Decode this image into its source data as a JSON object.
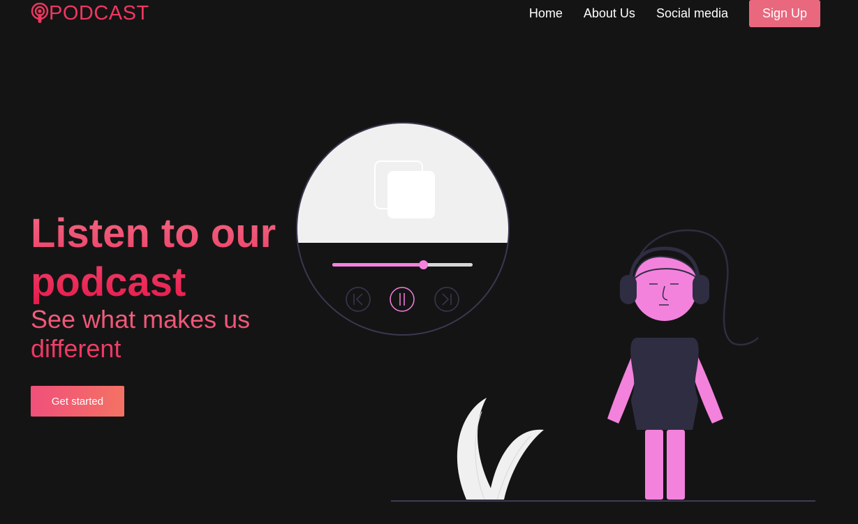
{
  "header": {
    "logo_text": "PODCAST",
    "nav": [
      {
        "label": "Home"
      },
      {
        "label": "About Us"
      },
      {
        "label": "Social media"
      }
    ],
    "signup_label": "Sign Up"
  },
  "hero": {
    "title": "Listen to our podcast",
    "subtitle": "See what makes us different",
    "cta_label": "Get started"
  },
  "player": {
    "progress": 0.65,
    "controls": [
      "previous-icon",
      "pause-icon",
      "next-icon"
    ]
  },
  "colors": {
    "background": "#151415",
    "brand": "#f0375f",
    "button": "#e9687e",
    "accent_pink": "#f382dd",
    "dark_figure": "#2f2d41"
  }
}
